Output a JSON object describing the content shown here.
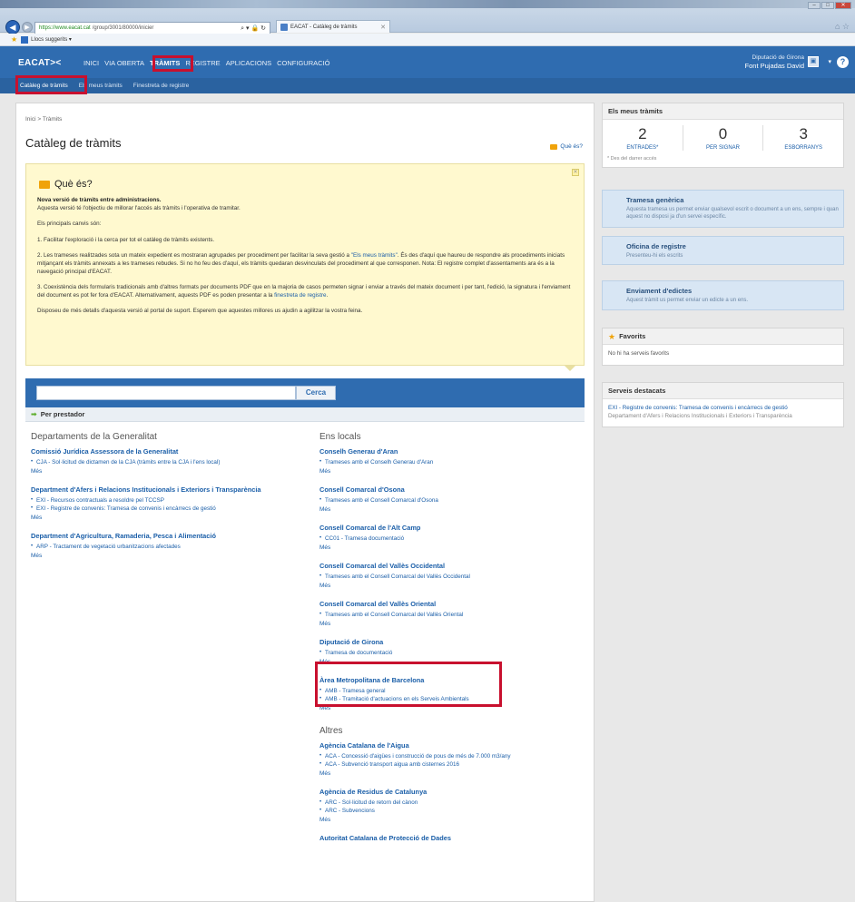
{
  "browser": {
    "url_host": "https://www.eacat.cat",
    "url_path": "/group/3001/80000/inicier",
    "tab_title": "EACAT - Catàleg de tràmits",
    "favorites_item": "Llocs suggerits ▾"
  },
  "header": {
    "logo": "EACAT><",
    "nav": [
      "INICI",
      "VIA OBERTA",
      "TRÀMITS",
      "REGISTRE",
      "APLICACIONS",
      "CONFIGURACIÓ"
    ],
    "org": "Diputació de Girona",
    "user": "Font Pujadas David",
    "help": "?"
  },
  "subnav": [
    "Catàleg de tràmits",
    "Els meus tràmits",
    "Finestreta de registre"
  ],
  "main": {
    "breadcrumb": "Inici > Tràmits",
    "title": "Catàleg de tràmits",
    "que_es_link": "Què és?"
  },
  "info": {
    "title": "Què és?",
    "lead_bold": "Nova versió de tràmits entre administracions.",
    "lead_text": "Aquesta versió té l'objectiu de millorar l'accés als tràmits i l'operativa de tramitar.",
    "p1": "Els principals canvis són:",
    "p2": "1. Facilitar l'exploració i la cerca per tot el catàleg de tràmits existents.",
    "p3a": "2. Les trameses realitzades sota un mateix expedient es mostraran agrupades per procediment per facilitar la seva gestió a ",
    "p3link": "\"Els meus tràmits\"",
    "p3b": ". És des d'aquí que haureu de respondre als procediments iniciats mitjançant els tràmits annexats a les trameses rebudes. Si no ho feu des d'aquí, els tràmits quedaran desvinculats del procediment al que corresponen. Nota: El registre complet d'assentaments ara és a la navegació principal d'EACAT.",
    "p4a": "3. Coexistència dels formularis tradicionals amb d'altres formats per documents PDF que en la majoria de casos permeten signar i enviar a través del mateix document i per tant, l'edició, la signatura i l'enviament del document es pot fer fora d'EACAT. Alternativament, aquests PDF es poden presentar a la ",
    "p4link": "finestreta de registre",
    "p4b": ".",
    "p5": "Disposeu de més detalls d'aquesta versió al portal de suport. Esperem que aquestes millores us ajudin a agilitzar la vostra feina."
  },
  "search": {
    "placeholder": "",
    "button": "Cerca"
  },
  "per_prestador": "Per prestador",
  "left_column": {
    "heading": "Departaments de la Generalitat",
    "groups": [
      {
        "title": "Comissió Jurídica Assessora de la Generalitat",
        "items": [
          "CJA - Sol·licitud de dictamen de la CJA (tràmits entre la CJA i l'ens local)"
        ],
        "more": "Més"
      },
      {
        "title": "Department d'Afers i Relacions Institucionals i Exteriors i Transparència",
        "items": [
          "EXI - Recursos contractuals a resoldre pel TCCSP",
          "EXI - Registre de convenis: Tramesa de convenis i encàrrecs de gestió"
        ],
        "more": "Més"
      },
      {
        "title": "Department d'Agricultura, Ramaderia, Pesca i Alimentació",
        "items": [
          "ARP - Tractament de vegetació urbanitzacions afectades"
        ],
        "more": "Més"
      }
    ]
  },
  "right_column": {
    "heading": "Ens locals",
    "groups": [
      {
        "title": "Conselh Generau d'Aran",
        "items": [
          "Trameses amb el Conselh Generau d'Aran"
        ],
        "more": "Més"
      },
      {
        "title": "Consell Comarcal d'Osona",
        "items": [
          "Trameses amb el Consell Comarcal d'Osona"
        ],
        "more": "Més"
      },
      {
        "title": "Consell Comarcal de l'Alt Camp",
        "items": [
          "CC01 - Tramesa documentació"
        ],
        "more": "Més"
      },
      {
        "title": "Consell Comarcal del Vallès Occidental",
        "items": [
          "Trameses amb el Consell Comarcal del Vallès Occidental"
        ],
        "more": "Més"
      },
      {
        "title": "Consell Comarcal del Vallès Oriental",
        "items": [
          "Trameses amb el Consell Comarcal del Vallès Oriental"
        ],
        "more": "Més"
      },
      {
        "title": "Diputació de Girona",
        "items": [
          "Tramesa de documentació"
        ],
        "more": "Més"
      },
      {
        "title": "Àrea Metropolitana de Barcelona",
        "items": [
          "AMB - Tramesa general",
          "AMB - Tramitació d'actuacions en els Serveis Ambientals"
        ],
        "more": "Més"
      }
    ],
    "heading2": "Altres",
    "groups2": [
      {
        "title": "Agència Catalana de l'Aigua",
        "items": [
          "ACA - Concessió d'aigües i construcció de pous de més de 7.000 m3/any",
          "ACA - Subvenció transport aigua amb cisternes 2016"
        ],
        "more": "Més"
      },
      {
        "title": "Agència de Residus de Catalunya",
        "items": [
          "ARC - Sol·licitud de retorn del cànon",
          "ARC - Subvencions"
        ],
        "more": "Més"
      },
      {
        "title": "Autoritat Catalana de Protecció de Dades",
        "items": [],
        "more": ""
      }
    ]
  },
  "sidebar": {
    "meus_tramits": {
      "title": "Els meus tràmits",
      "counters": [
        {
          "value": "2",
          "label": "ENTRADES*"
        },
        {
          "value": "0",
          "label": "PER SIGNAR"
        },
        {
          "value": "3",
          "label": "ESBORRANYS"
        }
      ],
      "note": "* Des del darrer accés"
    },
    "links": [
      {
        "title": "Tramesa genèrica",
        "desc": "Aquesta tramesa us permet enviar qualsevol escrit o document a un ens, sempre i quan aquest no disposi ja d'un servei específic."
      },
      {
        "title": "Oficina de registre",
        "desc": "Presenteu-hi els escrits"
      },
      {
        "title": "Enviament d'edictes",
        "desc": "Aquest tràmit us permet enviar un edicte a un ens."
      }
    ],
    "favorits": {
      "title": "Favorits",
      "empty": "No hi ha serveis favorits"
    },
    "destacats": {
      "title": "Serveis destacats",
      "link": "EXI - Registre de convenis: Tramesa de convenis i encàrrecs de gestió",
      "sub": "Departament d'Afers i Relacions Institucionals i Exteriors i Transparència"
    }
  }
}
